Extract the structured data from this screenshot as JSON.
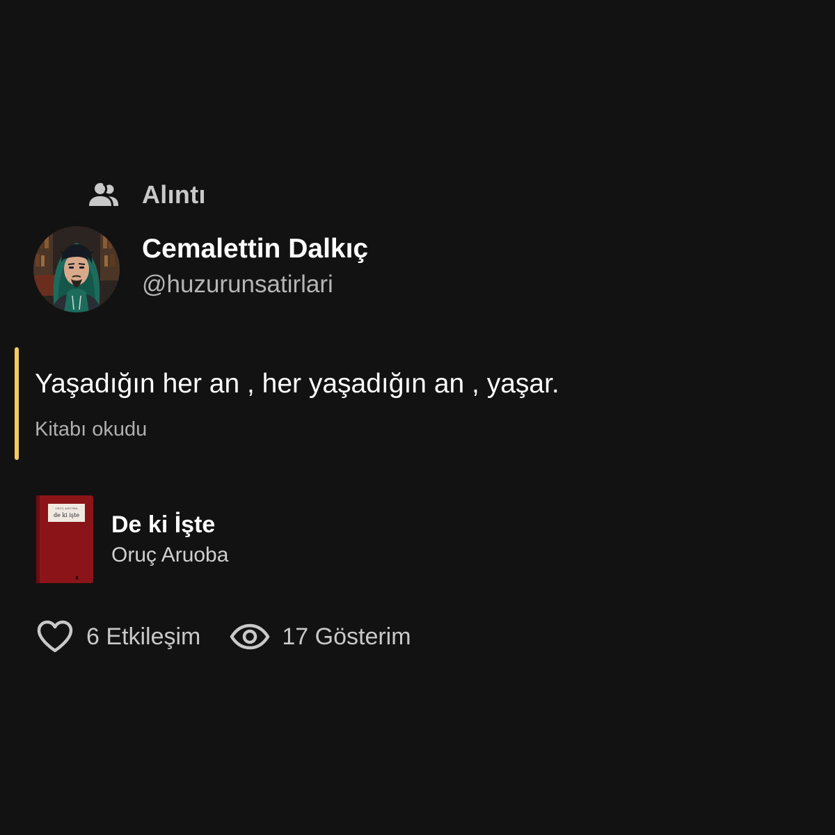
{
  "post": {
    "type_label": "Alıntı",
    "type_icon": "users-icon",
    "author": {
      "name": "Cemalettin Dalkıç",
      "handle": "@huzurunsatirlari",
      "avatar": "avatar-illustration"
    },
    "quote": {
      "text": "Yaşadığın her an , her yaşadığın an , yaşar.",
      "status": "Kitabı okudu",
      "accent_color": "#f5c96a"
    },
    "book": {
      "title": "De ki İşte",
      "author": "Oruç Aruoba",
      "cover_author_small": "ORUÇ ARUOBA",
      "cover_title_small": "de ki işte",
      "cover_color": "#8a1418"
    },
    "stats": {
      "likes": "6 Etkileşim",
      "likes_icon": "heart-icon",
      "views": "17 Gösterim",
      "views_icon": "eye-icon"
    }
  },
  "colors": {
    "background": "#121212",
    "primary_text": "#ffffff",
    "secondary_text": "#b5b5b5"
  }
}
